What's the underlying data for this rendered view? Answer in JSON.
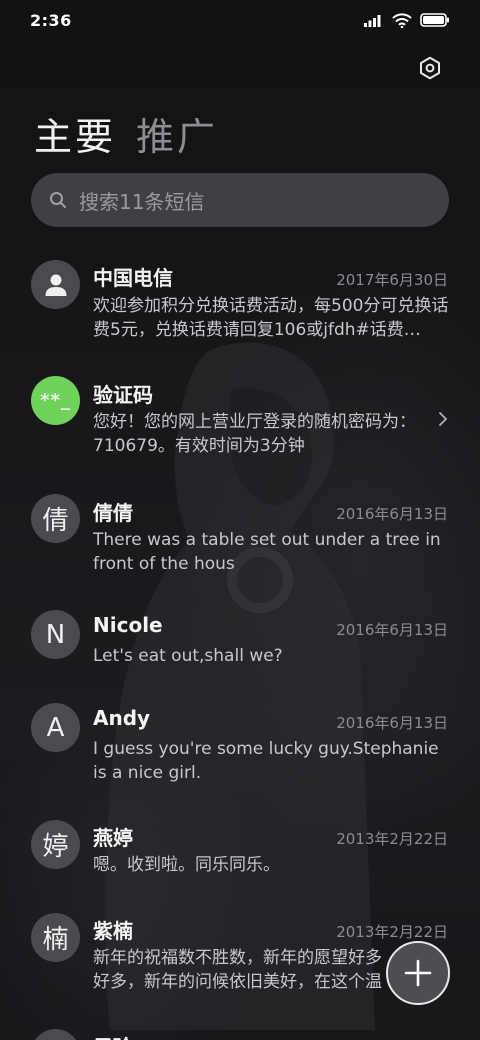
{
  "status": {
    "time": "2:36"
  },
  "tabs": {
    "primary": "主要",
    "promo": "推广"
  },
  "search": {
    "placeholder": "搜索11条短信"
  },
  "conversations": [
    {
      "name": "中国电信",
      "date": "2017年6月30日",
      "preview": "欢迎参加积分兑换话费活动，每500分可兑换话费5元，兑换话费请回复106或jfdh#话费…",
      "avatar": "person-icon"
    },
    {
      "name": "验证码",
      "date": "",
      "preview": "您好！您的网上营业厅登录的随机密码为：710679。有效时间为3分钟",
      "avatar_text": "**_"
    },
    {
      "name": "倩倩",
      "date": "2016年6月13日",
      "preview": "There was a table set out under a tree in front of the hous",
      "avatar_text": "倩"
    },
    {
      "name": "Nicole",
      "date": "2016年6月13日",
      "preview": "Let's eat out,shall we?",
      "avatar_text": "N"
    },
    {
      "name": "Andy",
      "date": "2016年6月13日",
      "preview": "I guess you're some lucky guy.Stephanie is a nice girl.",
      "avatar_text": "A"
    },
    {
      "name": "燕婷",
      "date": "2013年2月22日",
      "preview": "嗯。收到啦。同乐同乐。",
      "avatar_text": "婷"
    },
    {
      "name": "紫楠",
      "date": "2013年2月22日",
      "preview": "新年的祝福数不胜数，新年的愿望好多好多，新年的问候依旧美好，在这个温馨的时刻",
      "avatar_text": "楠"
    },
    {
      "name": "子玲",
      "date": "",
      "preview": "",
      "avatar_text": ""
    }
  ],
  "colors": {
    "verify_avatar": "#6fd25a",
    "background": "#1a1a1d"
  }
}
